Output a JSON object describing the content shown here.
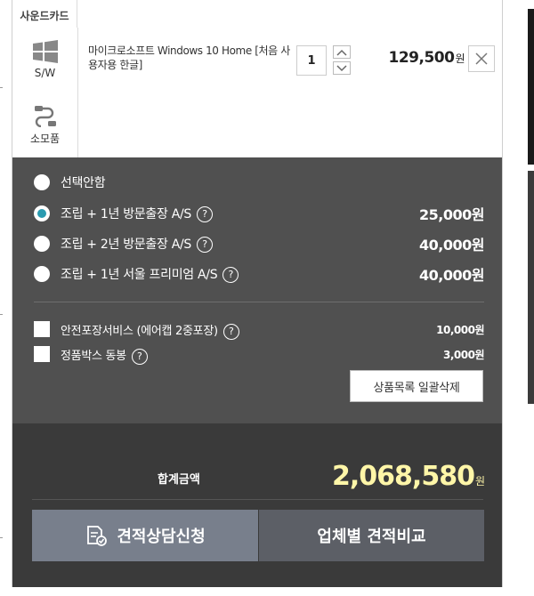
{
  "products": {
    "sound": {
      "category": "사운드카드"
    },
    "software": {
      "category": "S/W",
      "name": "마이크로소프트 Windows 10 Home [처음 사용자용 한글]",
      "quantity": "1",
      "price": "129,500",
      "currency": "원"
    },
    "consumables": {
      "category": "소모품"
    }
  },
  "services": [
    {
      "label": "선택안함",
      "price": "",
      "selected": false,
      "help": false
    },
    {
      "label": "조립 + 1년 방문출장 A/S",
      "price": "25,000원",
      "selected": true,
      "help": true
    },
    {
      "label": "조립 + 2년 방문출장 A/S",
      "price": "40,000원",
      "selected": false,
      "help": true
    },
    {
      "label": "조립 + 1년 서울 프리미엄 A/S",
      "price": "40,000원",
      "selected": false,
      "help": true
    }
  ],
  "addons": [
    {
      "label": "안전포장서비스 (에어캡 2중포장)",
      "price": "10,000원",
      "help": true
    },
    {
      "label": "정품박스 동봉",
      "price": "3,000원",
      "help": true
    }
  ],
  "actions": {
    "bulk_delete": "상품목록 일괄삭제",
    "consult": "견적상담신청",
    "compare": "업체별 견적비교"
  },
  "total": {
    "label": "합계금액",
    "value": "2,068,580",
    "currency": "원"
  },
  "help_glyph": "?",
  "colors": {
    "panel": "#505050",
    "total_bg": "#3a3a3a",
    "total_value": "#fff6a8",
    "radio_selected": "#2a9bb0",
    "consult_button": "#787f8c",
    "compare_button": "#5c5f66"
  },
  "icons": {
    "software": "windows-icon",
    "consumables": "cable-icon",
    "quantity_up": "chevron-up-icon",
    "quantity_down": "chevron-down-icon",
    "remove": "close-icon",
    "consult": "document-check-icon"
  }
}
